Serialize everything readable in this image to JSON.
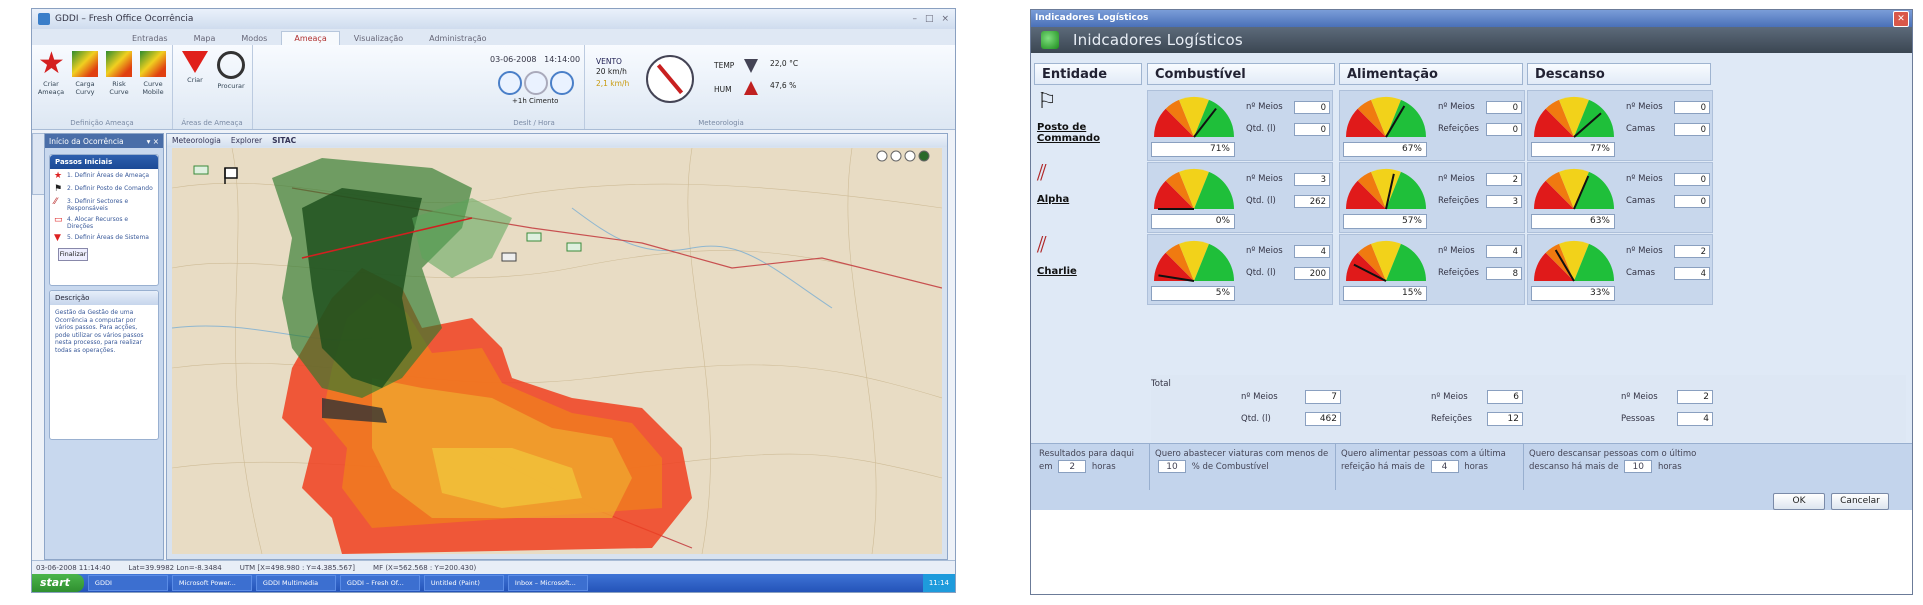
{
  "left_app": {
    "window_title": "GDDI – Fresh Office Ocorrência",
    "tabs": [
      "Entradas",
      "Mapa",
      "Modos",
      "Ameaça",
      "Visualização",
      "Administração"
    ],
    "ribbon": {
      "btn_ameaca": "Criar Ameaça",
      "btn_carga1": "Carga Curvy",
      "btn_carga2": "Risk Curve",
      "btn_carga3": "Curve Mobile",
      "group1": "Definição Ameaça",
      "btn_criar": "Criar",
      "btn_procurar": "Procurar",
      "group2": "Áreas de Ameaça",
      "date": "03-06-2008",
      "time": "14:14:00",
      "time_offset": "+1h Cimento",
      "group3": "Deslt / Hora",
      "vento_label": "VENTO",
      "vento_value": "20 km/h",
      "vento_sub": "2,1 km/h",
      "temp_label": "TEMP",
      "temp_value": "22,0 °C",
      "umid_label": "HUM",
      "umid_value": "47,6 %",
      "group4": "Meteorologia"
    },
    "sidebar": {
      "header": "Início da Ocorrência",
      "panel1_title": "Passos Iniciais",
      "steps": [
        "1. Definir Áreas de Ameaça",
        "2. Definir Posto de Comando",
        "3. Definir Sectores e Responsáveis",
        "4. Alocar Recursos e Direções",
        "5. Definir Áreas de Sistema"
      ],
      "finish_btn": "Finalizar",
      "panel2_title": "Descrição",
      "description": "Gestão da Gestão de uma Ocorrência a computar por vários passos. Para acções, pode utilizar os vários passos nesta processo, para realizar todas as operações."
    },
    "map_tabs": [
      "Meteorologia",
      "Explorer",
      "SITAC"
    ],
    "status": {
      "datetime": "03-06-2008  11:14:40",
      "latlon": "Lat=39.9982 Lon=-8.3484",
      "utm": "UTM [X=498.980 : Y=4.385.567]",
      "mgrs": "MF (X=562.568 : Y=200.430)"
    },
    "taskbar": {
      "start": "start",
      "tasks": [
        "GDDI",
        "Microsoft Power...",
        "GDDI Multimédia",
        "GDDI – Fresh Of...",
        "Untitled (Paint)",
        "Inbox – Microsoft..."
      ],
      "clock": "11:14"
    }
  },
  "dialog": {
    "title_bar": "Indicadores Logísticos",
    "header_title": "Inidcadores Logísticos",
    "columns": [
      "Entidade",
      "Combustível",
      "Alimentação",
      "Descanso"
    ],
    "entities": [
      {
        "name": "Posto de Commando",
        "icon": "flag-icon",
        "combustivel": {
          "pct_text": "71%",
          "pct": 71,
          "l1": "nº Meios",
          "v1": "0",
          "l2": "Qtd. (l)",
          "v2": "0"
        },
        "alimentacao": {
          "pct_text": "67%",
          "pct": 67,
          "l1": "nº Meios",
          "v1": "0",
          "l2": "Refeições",
          "v2": "0"
        },
        "descanso": {
          "pct_text": "77%",
          "pct": 77,
          "l1": "nº Meios",
          "v1": "0",
          "l2": "Camas",
          "v2": "0"
        }
      },
      {
        "name": "Alpha",
        "icon": "sector-hatch-icon",
        "combustivel": {
          "pct_text": "0%",
          "pct": 0,
          "l1": "nº Meios",
          "v1": "3",
          "l2": "Qtd. (l)",
          "v2": "262"
        },
        "alimentacao": {
          "pct_text": "57%",
          "pct": 57,
          "l1": "nº Meios",
          "v1": "2",
          "l2": "Refeições",
          "v2": "3"
        },
        "descanso": {
          "pct_text": "63%",
          "pct": 63,
          "l1": "nº Meios",
          "v1": "0",
          "l2": "Camas",
          "v2": "0"
        }
      },
      {
        "name": "Charlie",
        "icon": "sector-hatch-icon",
        "combustivel": {
          "pct_text": "5%",
          "pct": 5,
          "l1": "nº Meios",
          "v1": "4",
          "l2": "Qtd. (l)",
          "v2": "200"
        },
        "alimentacao": {
          "pct_text": "15%",
          "pct": 15,
          "l1": "nº Meios",
          "v1": "4",
          "l2": "Refeições",
          "v2": "8"
        },
        "descanso": {
          "pct_text": "33%",
          "pct": 33,
          "l1": "nº Meios",
          "v1": "2",
          "l2": "Camas",
          "v2": "4"
        }
      }
    ],
    "totals": {
      "label": "Total",
      "comb_l1": "nº Meios",
      "comb_v1": "7",
      "comb_l2": "Qtd. (l)",
      "comb_v2": "462",
      "alim_l1": "nº Meios",
      "alim_v1": "6",
      "alim_l2": "Refeições",
      "alim_v2": "12",
      "desc_l1": "nº Meios",
      "desc_v1": "2",
      "desc_l2": "Pessoas",
      "desc_v2": "4"
    },
    "bottom": {
      "s1_line1": "Resultados para daqui",
      "s1_pre": "em",
      "s1_value": "2",
      "s1_post": "horas",
      "s2_line1": "Quero abastecer viaturas com menos de",
      "s2_value": "10",
      "s2_post": "% de Combustível",
      "s3_line1": "Quero alimentar pessoas com a última",
      "s3_pre": "refeição há mais de",
      "s3_value": "4",
      "s3_post": "horas",
      "s4_line1": "Quero descansar pessoas com o último",
      "s4_pre": "descanso há mais de",
      "s4_value": "10",
      "s4_post": "horas"
    },
    "ok_label": "OK",
    "cancel_label": "Cancelar"
  },
  "colors": {
    "gauge_red": "#e01a1a",
    "gauge_orange": "#f07a10",
    "gauge_yellow": "#f2d21a",
    "gauge_green": "#1fbf3a",
    "needle": "#111111"
  }
}
